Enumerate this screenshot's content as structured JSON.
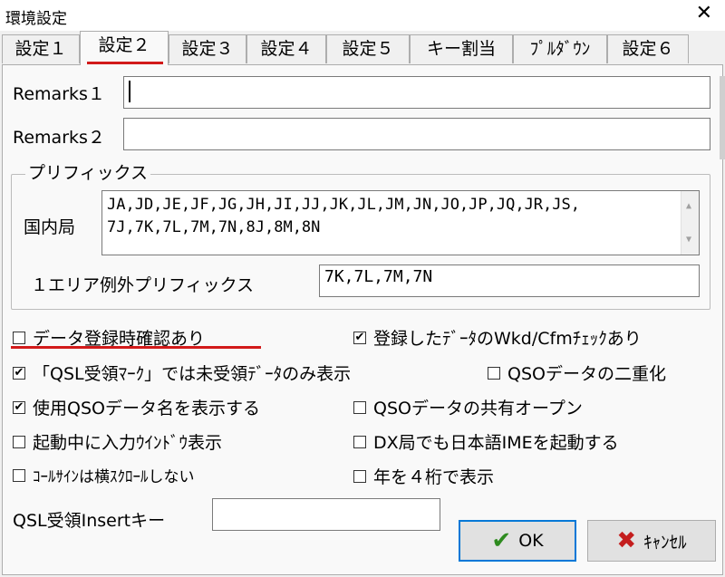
{
  "window": {
    "title": "環境設定",
    "close_glyph": "✕"
  },
  "tabs": [
    {
      "label": "設定１",
      "active": false
    },
    {
      "label": "設定２",
      "active": true
    },
    {
      "label": "設定３",
      "active": false
    },
    {
      "label": "設定４",
      "active": false
    },
    {
      "label": "設定５",
      "active": false
    },
    {
      "label": "キー割当",
      "active": false
    },
    {
      "label": "ﾌﾟﾙﾀﾞｳﾝ",
      "active": false
    },
    {
      "label": "設定６",
      "active": false
    }
  ],
  "remarks1": {
    "label": "Remarks１",
    "value": ""
  },
  "remarks2": {
    "label": "Remarks２",
    "value": ""
  },
  "prefix_group": {
    "title": "プリフィックス",
    "domestic_label": "国内局",
    "domestic_lines": [
      "JA,JD,JE,JF,JG,JH,JI,JJ,JK,JL,JM,JN,JO,JP,JQ,JR,JS,",
      "7J,7K,7L,7M,7N,8J,8M,8N"
    ],
    "area1_label": "１エリア例外プリフィックス",
    "area1_value": "7K,7L,7M,7N"
  },
  "checkboxes": {
    "confirm_register": {
      "label": "データ登録時確認あり",
      "checked": false
    },
    "wkd_cfm_check": {
      "label": "登録したﾃﾞｰﾀのWkd/Cfmﾁｪｯｸあり",
      "checked": true
    },
    "qsl_mark_only": {
      "label": "「QSL受領ﾏｰｸ」では未受領ﾃﾞｰﾀのみ表示",
      "checked": true
    },
    "qso_duplicate": {
      "label": "QSOデータの二重化",
      "checked": false
    },
    "show_qso_name": {
      "label": "使用QSOデータ名を表示する",
      "checked": true
    },
    "qso_shared_open": {
      "label": "QSOデータの共有オープン",
      "checked": false
    },
    "input_window_startup": {
      "label": "起動中に入力ｳｲﾝﾄﾞｳ表示",
      "checked": false
    },
    "dx_japanese_ime": {
      "label": "DX局でも日本語IMEを起動する",
      "checked": false
    },
    "callsign_no_scroll": {
      "label": "ｺｰﾙｻｲﾝは横ｽｸﾛｰﾙしない",
      "checked": false
    },
    "year_4digit": {
      "label": "年を４桁で表示",
      "checked": false
    }
  },
  "qsl_insert": {
    "label": "QSL受領Insertキー",
    "value": ""
  },
  "buttons": {
    "ok": "OK",
    "cancel": "ｷｬﾝｾﾙ"
  },
  "glyphs": {
    "check": "✔",
    "cross": "✖",
    "up": "▲",
    "down": "▼"
  },
  "colors": {
    "highlight_red": "#d21a1a",
    "ok_green": "#2e8b1f",
    "cancel_red": "#c41e1e"
  }
}
